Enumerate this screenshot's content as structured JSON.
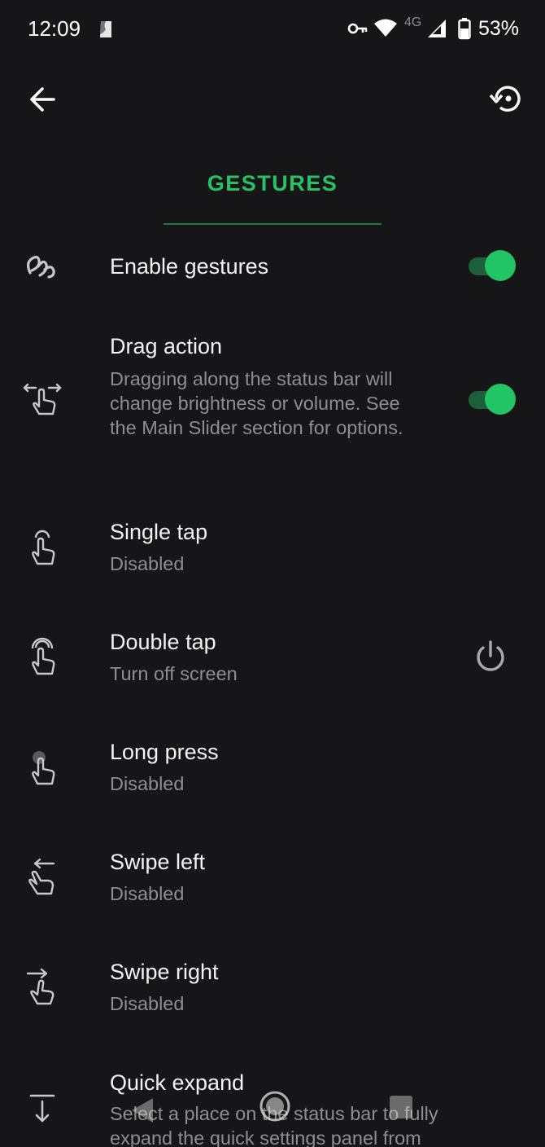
{
  "status_bar": {
    "time": "12:09",
    "network_label": "4G",
    "battery_percent": "53%",
    "icons": [
      "notification-icon",
      "vpn-key-icon",
      "wifi-icon",
      "cell-signal-icon",
      "battery-icon"
    ]
  },
  "app_bar": {
    "back_icon": "arrow-left-icon",
    "reset_icon": "restore-icon"
  },
  "tab": {
    "label": "GESTURES",
    "accent_color": "#27c264"
  },
  "rows": [
    {
      "icon": "squiggle-gesture-icon",
      "title": "Enable gestures",
      "subtitle": "",
      "toggle_on": true
    },
    {
      "icon": "drag-hand-icon",
      "title": "Drag action",
      "subtitle": "Dragging along the status bar will change brightness or volume. See the Main Slider section for options.",
      "toggle_on": true
    },
    {
      "icon": "single-tap-icon",
      "title": "Single tap",
      "subtitle": "Disabled"
    },
    {
      "icon": "double-tap-icon",
      "title": "Double tap",
      "subtitle": "Turn off screen",
      "action_icon": "power-icon"
    },
    {
      "icon": "long-press-icon",
      "title": "Long press",
      "subtitle": "Disabled"
    },
    {
      "icon": "swipe-left-icon",
      "title": "Swipe left",
      "subtitle": "Disabled"
    },
    {
      "icon": "swipe-right-icon",
      "title": "Swipe right",
      "subtitle": "Disabled"
    },
    {
      "icon": "arrow-down-to-line-icon",
      "title": "Quick expand",
      "subtitle": "Select a place on the status bar to fully expand the quick settings panel from"
    }
  ],
  "nav_bar": {
    "icons": [
      "nav-back-icon",
      "nav-home-icon",
      "nav-recents-icon"
    ]
  }
}
